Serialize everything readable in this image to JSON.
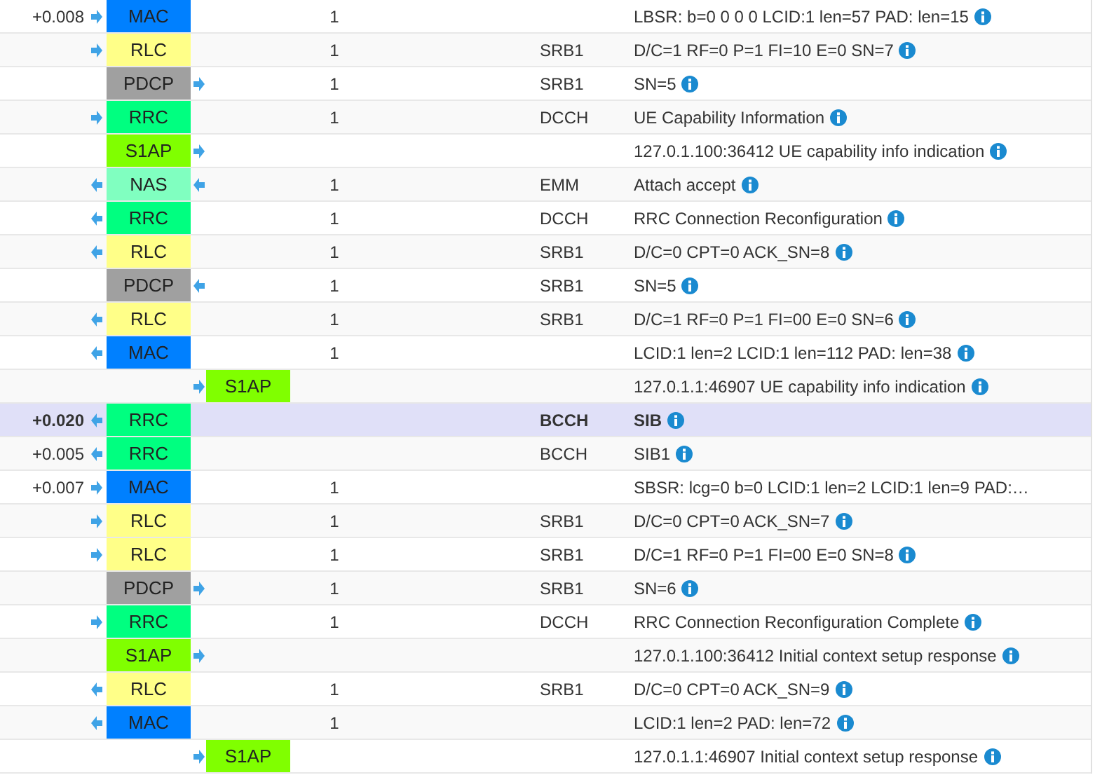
{
  "rows": [
    {
      "time": "+0.008",
      "arrow_before": true,
      "arrow_after": false,
      "uplink": true,
      "layer": "MAC",
      "color": "#0080ff",
      "kind": "stack",
      "count": "1",
      "info": "LBSR: b=0 0 0 0 LCID:1 len=57 PAD: len=15",
      "info_icon": true,
      "selected": false
    },
    {
      "arrow_before": true,
      "arrow_after": false,
      "uplink": true,
      "layer": "RLC",
      "color": "#ffff88",
      "kind": "stack",
      "count": "1",
      "channel": "SRB1",
      "info": "D/C=1 RF=0 P=1 FI=10 E=0 SN=7",
      "info_icon": true,
      "selected": false
    },
    {
      "arrow_before": false,
      "arrow_after": true,
      "uplink": true,
      "layer": "PDCP",
      "color": "#a0a0a0",
      "kind": "stack",
      "count": "1",
      "channel": "SRB1",
      "info": "SN=5",
      "info_icon": true,
      "selected": false
    },
    {
      "arrow_before": true,
      "arrow_after": false,
      "uplink": true,
      "layer": "RRC",
      "color": "#00ff80",
      "kind": "stack",
      "count": "1",
      "channel": "DCCH",
      "info": "UE Capability Information",
      "info_icon": true,
      "selected": false
    },
    {
      "arrow_before": false,
      "arrow_after": true,
      "uplink": true,
      "layer": "S1AP",
      "color": "#80ff00",
      "kind": "stack",
      "info": "127.0.1.100:36412 UE capability info indication",
      "info_icon": true,
      "selected": false
    },
    {
      "arrow_before": true,
      "arrow_after": true,
      "uplink": false,
      "layer": "NAS",
      "color": "#80ffc0",
      "kind": "stack",
      "count": "1",
      "channel": "EMM",
      "info": "Attach accept",
      "info_icon": true,
      "selected": false
    },
    {
      "arrow_before": true,
      "arrow_after": false,
      "uplink": false,
      "layer": "RRC",
      "color": "#00ff80",
      "kind": "stack",
      "count": "1",
      "channel": "DCCH",
      "info": "RRC Connection Reconfiguration",
      "info_icon": true,
      "selected": false
    },
    {
      "arrow_before": true,
      "arrow_after": false,
      "uplink": false,
      "layer": "RLC",
      "color": "#ffff88",
      "kind": "stack",
      "count": "1",
      "channel": "SRB1",
      "info": "D/C=0 CPT=0 ACK_SN=8",
      "info_icon": true,
      "selected": false
    },
    {
      "arrow_before": false,
      "arrow_after": true,
      "uplink": false,
      "layer": "PDCP",
      "color": "#a0a0a0",
      "kind": "stack",
      "count": "1",
      "channel": "SRB1",
      "info": "SN=5",
      "info_icon": true,
      "selected": false
    },
    {
      "arrow_before": true,
      "arrow_after": false,
      "uplink": false,
      "layer": "RLC",
      "color": "#ffff88",
      "kind": "stack",
      "count": "1",
      "channel": "SRB1",
      "info": "D/C=1 RF=0 P=1 FI=00 E=0 SN=6",
      "info_icon": true,
      "selected": false
    },
    {
      "arrow_before": true,
      "arrow_after": false,
      "uplink": false,
      "layer": "MAC",
      "color": "#0080ff",
      "kind": "stack",
      "count": "1",
      "info": "LCID:1 len=2 LCID:1 len=112 PAD: len=38",
      "info_icon": true,
      "selected": false
    },
    {
      "arrow_before": true,
      "uplink": true,
      "layer": "S1AP",
      "color": "#80ff00",
      "kind": "core",
      "info": "127.0.1.1:46907 UE capability info indication",
      "info_icon": true,
      "selected": false
    },
    {
      "time": "+0.020",
      "arrow_before": true,
      "arrow_after": false,
      "uplink": false,
      "layer": "RRC",
      "color": "#00ff80",
      "kind": "stack",
      "channel": "BCCH",
      "info": "SIB",
      "info_icon": true,
      "selected": true
    },
    {
      "time": "+0.005",
      "arrow_before": true,
      "arrow_after": false,
      "uplink": false,
      "layer": "RRC",
      "color": "#00ff80",
      "kind": "stack",
      "channel": "BCCH",
      "info": "SIB1",
      "info_icon": true,
      "selected": false
    },
    {
      "time": "+0.007",
      "arrow_before": true,
      "arrow_after": false,
      "uplink": true,
      "layer": "MAC",
      "color": "#0080ff",
      "kind": "stack",
      "count": "1",
      "info": "SBSR: lcg=0 b=0 LCID:1 len=2 LCID:1 len=9 PAD:…",
      "info_icon": false,
      "selected": false
    },
    {
      "arrow_before": true,
      "arrow_after": false,
      "uplink": true,
      "layer": "RLC",
      "color": "#ffff88",
      "kind": "stack",
      "count": "1",
      "channel": "SRB1",
      "info": "D/C=0 CPT=0 ACK_SN=7",
      "info_icon": true,
      "selected": false
    },
    {
      "arrow_before": true,
      "arrow_after": false,
      "uplink": true,
      "layer": "RLC",
      "color": "#ffff88",
      "kind": "stack",
      "count": "1",
      "channel": "SRB1",
      "info": "D/C=1 RF=0 P=1 FI=00 E=0 SN=8",
      "info_icon": true,
      "selected": false
    },
    {
      "arrow_before": false,
      "arrow_after": true,
      "uplink": true,
      "layer": "PDCP",
      "color": "#a0a0a0",
      "kind": "stack",
      "count": "1",
      "channel": "SRB1",
      "info": "SN=6",
      "info_icon": true,
      "selected": false
    },
    {
      "arrow_before": true,
      "arrow_after": false,
      "uplink": true,
      "layer": "RRC",
      "color": "#00ff80",
      "kind": "stack",
      "count": "1",
      "channel": "DCCH",
      "info": "RRC Connection Reconfiguration Complete",
      "info_icon": true,
      "selected": false
    },
    {
      "arrow_before": false,
      "arrow_after": true,
      "uplink": true,
      "layer": "S1AP",
      "color": "#80ff00",
      "kind": "stack",
      "info": "127.0.1.100:36412 Initial context setup response",
      "info_icon": true,
      "selected": false
    },
    {
      "arrow_before": true,
      "arrow_after": false,
      "uplink": false,
      "layer": "RLC",
      "color": "#ffff88",
      "kind": "stack",
      "count": "1",
      "channel": "SRB1",
      "info": "D/C=0 CPT=0 ACK_SN=9",
      "info_icon": true,
      "selected": false
    },
    {
      "arrow_before": true,
      "arrow_after": false,
      "uplink": false,
      "layer": "MAC",
      "color": "#0080ff",
      "kind": "stack",
      "count": "1",
      "info": "LCID:1 len=2 PAD: len=72",
      "info_icon": true,
      "selected": false
    },
    {
      "arrow_before": true,
      "uplink": true,
      "layer": "S1AP",
      "color": "#80ff00",
      "kind": "core",
      "info": "127.0.1.1:46907 Initial context setup response",
      "info_icon": true,
      "selected": false
    }
  ]
}
